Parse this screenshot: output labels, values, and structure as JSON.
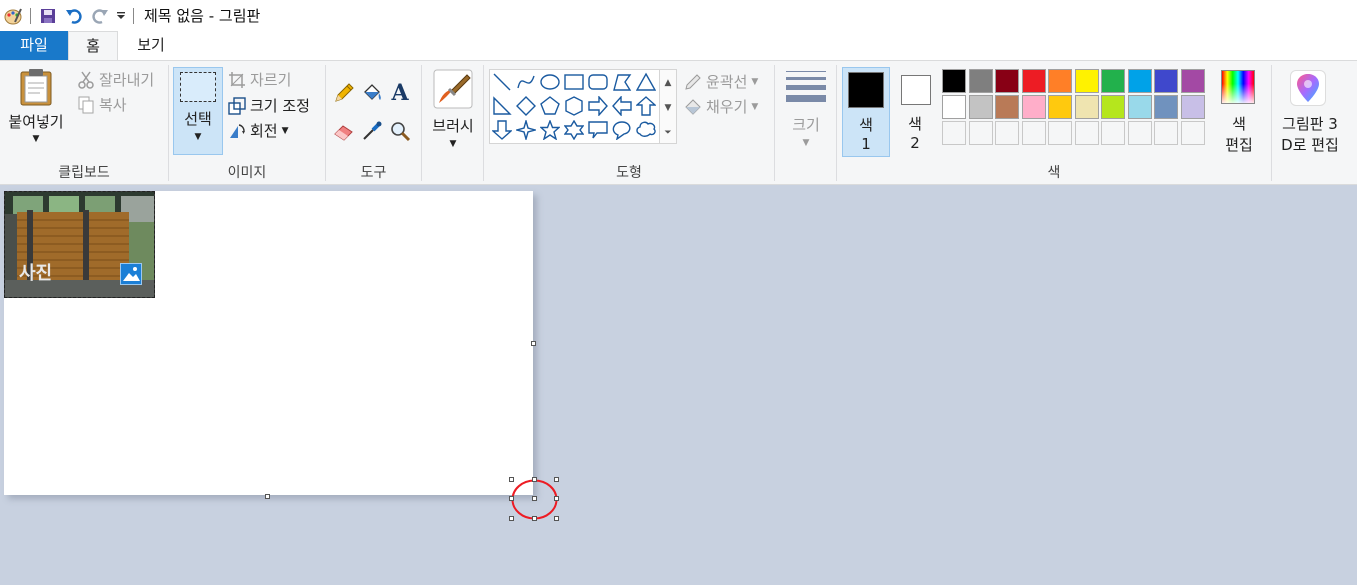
{
  "window": {
    "title": "제목 없음 - 그림판"
  },
  "tabs": {
    "file": "파일",
    "home": "홈",
    "view": "보기"
  },
  "clipboard": {
    "paste": "붙여넣기",
    "cut": "잘라내기",
    "copy": "복사",
    "label": "클립보드"
  },
  "image": {
    "select": "선택",
    "crop": "자르기",
    "resize": "크기 조정",
    "rotate": "회전",
    "label": "이미지"
  },
  "tools": {
    "label": "도구"
  },
  "brushes": {
    "label": "브러시"
  },
  "shapes": {
    "outline": "윤곽선",
    "fill": "채우기",
    "label": "도형"
  },
  "size": {
    "label": "크기"
  },
  "colors": {
    "color1_a": "색",
    "color1_b": "1",
    "color2_a": "색",
    "color2_b": "2",
    "edit_a": "색",
    "edit_b": "편집",
    "label": "색",
    "color1_value": "#000000",
    "color2_value": "#ffffff",
    "palette_row1": [
      "#000000",
      "#7f7f7f",
      "#880015",
      "#ed1c24",
      "#ff7f27",
      "#fff200",
      "#22b14c",
      "#00a2e8",
      "#3f48cc",
      "#a349a4"
    ],
    "palette_row2": [
      "#ffffff",
      "#c3c3c3",
      "#b97a57",
      "#ffaec9",
      "#ffc90e",
      "#efe4b0",
      "#b5e61d",
      "#99d9ea",
      "#7092be",
      "#c8bfe7"
    ]
  },
  "paint3d": {
    "line1": "그림판 3",
    "line2": "D로 편집"
  },
  "canvas": {
    "photo_label": "사진"
  }
}
